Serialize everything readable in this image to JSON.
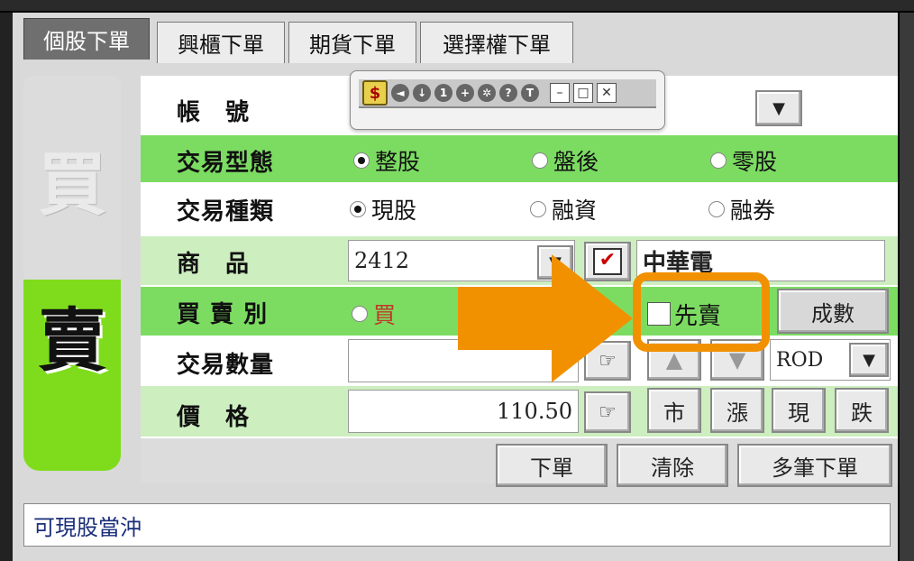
{
  "tabs": [
    {
      "label": "個股下單",
      "active": true
    },
    {
      "label": "興櫃下單",
      "active": false
    },
    {
      "label": "期貨下單",
      "active": false
    },
    {
      "label": "選擇權下單",
      "active": false
    }
  ],
  "side": {
    "buy": "買",
    "sell": "賣"
  },
  "form": {
    "account_label": "帳　號",
    "trade_type_label": "交易型態",
    "trade_type_options": [
      "整股",
      "盤後",
      "零股"
    ],
    "trade_kind_label": "交易種類",
    "trade_kind_options": [
      "現股",
      "融資",
      "融券"
    ],
    "product_label": "商　品",
    "product_code": "2412",
    "product_name": "中華電",
    "buysell_label": "買 賣 別",
    "buy_option": "買",
    "sell_first_label": "先賣",
    "lots_button": "成數",
    "quantity_label": "交易數量",
    "quantity_value": "",
    "time_in_force": "ROD",
    "price_label": "價　格",
    "price_value": "110.50",
    "price_buttons": [
      "市",
      "漲",
      "現",
      "跌"
    ]
  },
  "actions": {
    "submit": "下單",
    "clear": "清除",
    "batch": "多筆下單"
  },
  "status": {
    "message": "可現股當沖"
  },
  "colors": {
    "row_green": "#7cdc62",
    "sell_green": "#7fdc1c",
    "annotation_orange": "#f29100"
  }
}
